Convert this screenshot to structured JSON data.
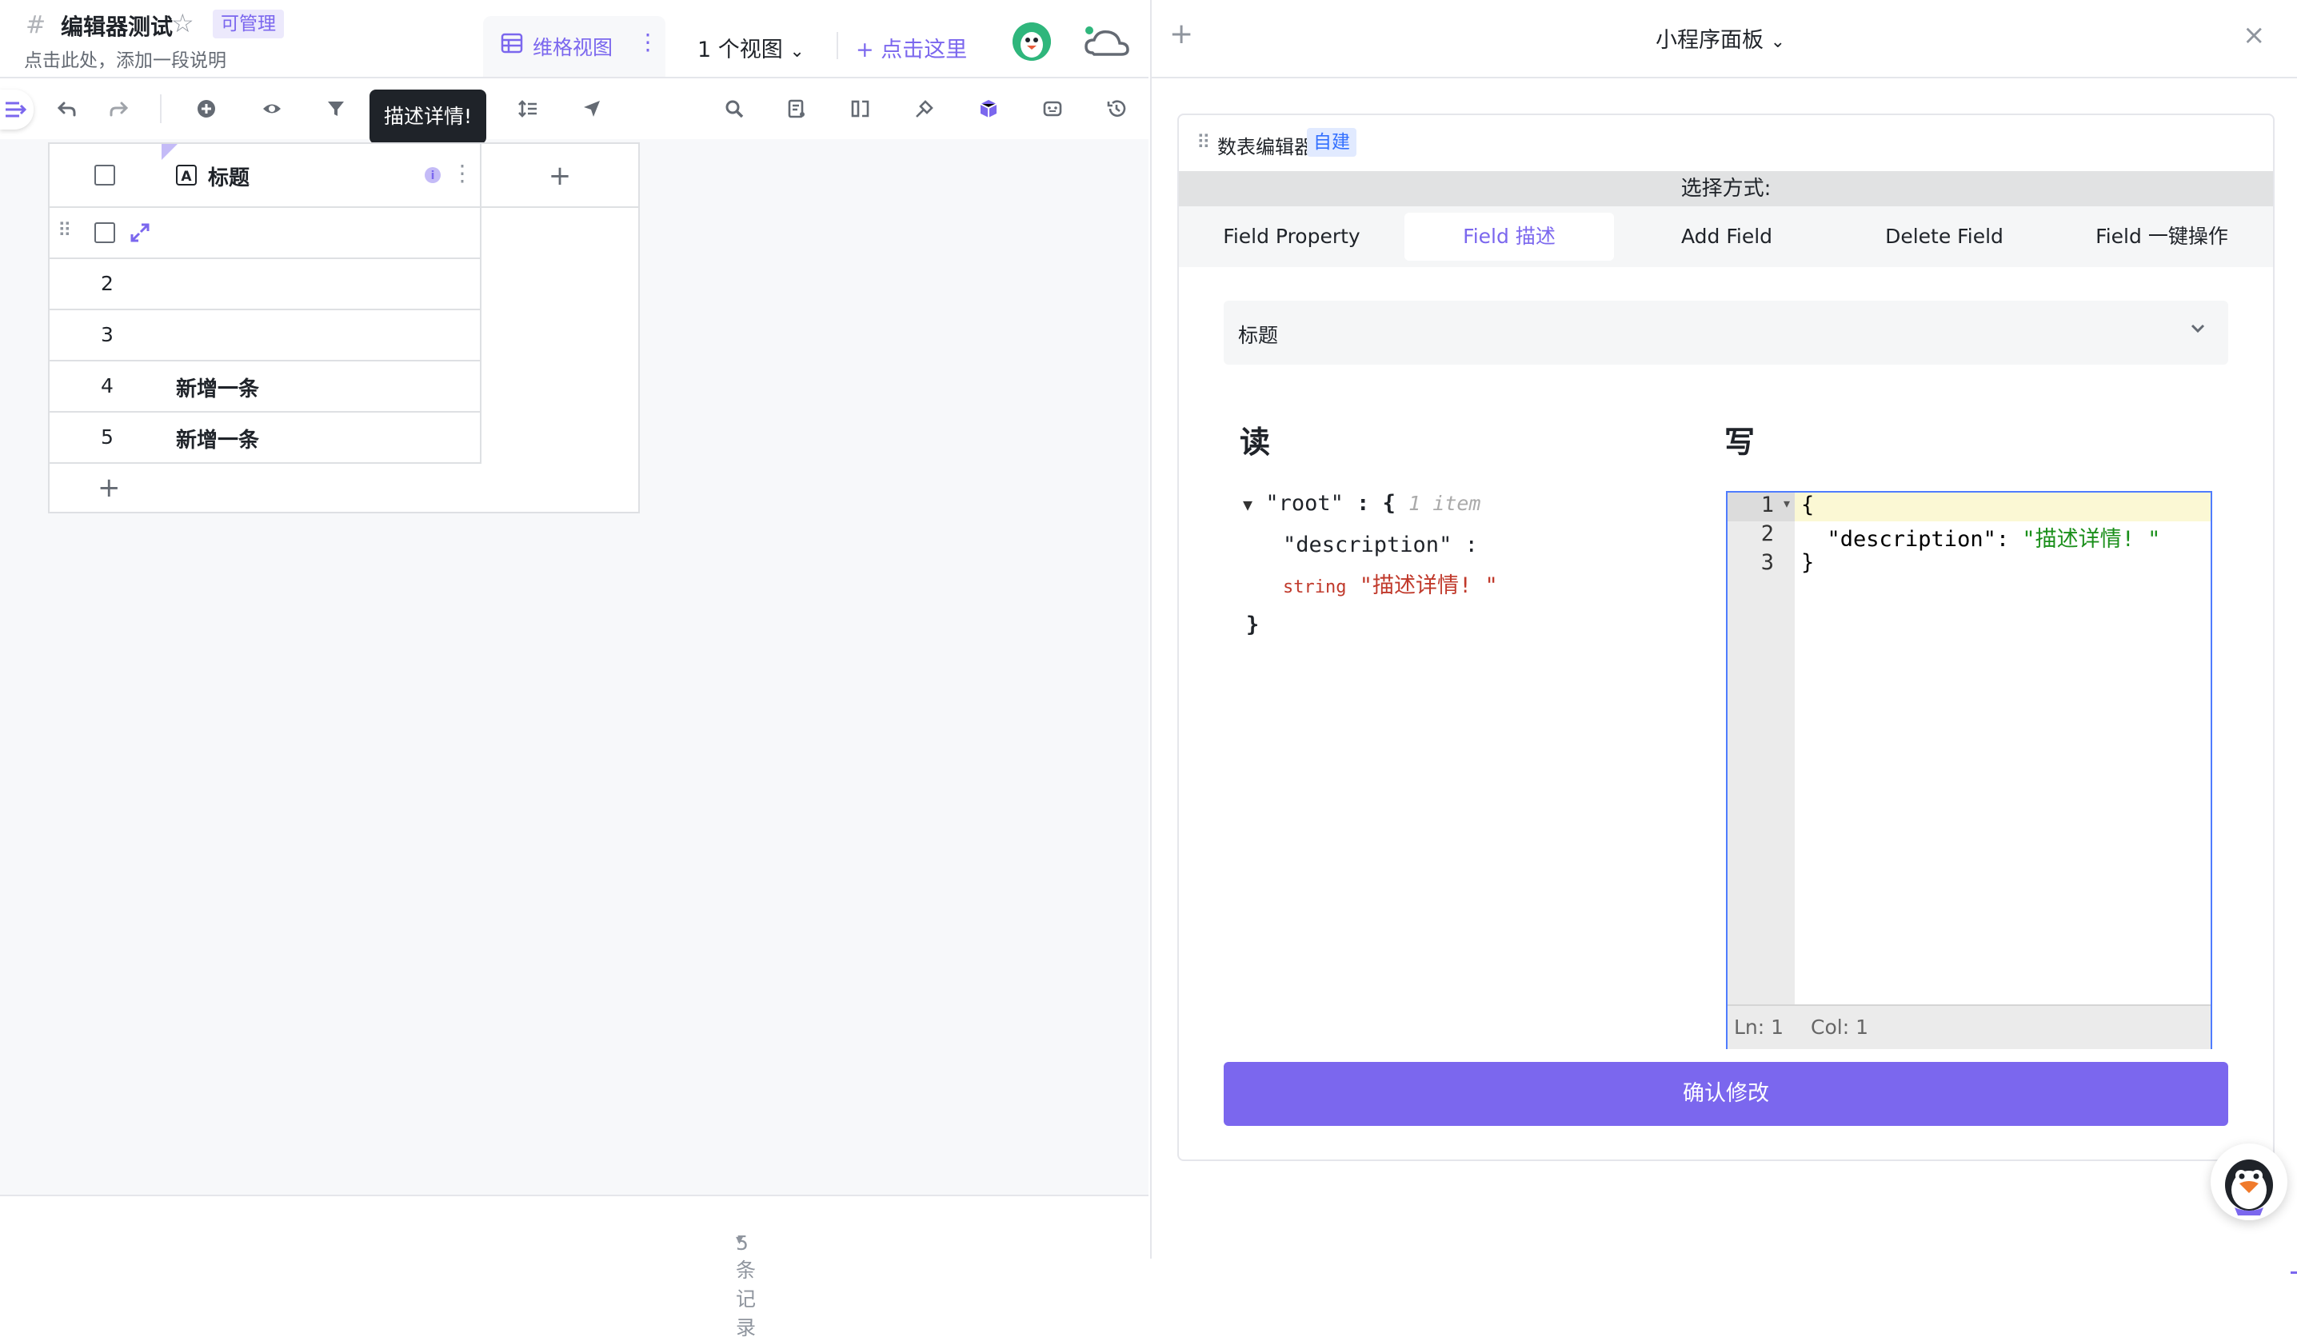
{
  "header": {
    "title": "编辑器测试",
    "badge": "可管理",
    "description": "点击此处，添加一段说明",
    "view_tab_label": "维格视图",
    "view_count": "1 个视图",
    "add_view": "点击这里"
  },
  "tooltip": "描述详情!",
  "grid": {
    "field_name": "标题",
    "rows": [
      {
        "num": "",
        "text": ""
      },
      {
        "num": "2",
        "text": ""
      },
      {
        "num": "3",
        "text": ""
      },
      {
        "num": "4",
        "text": "新增一条"
      },
      {
        "num": "5",
        "text": "新增一条"
      }
    ]
  },
  "footer": {
    "record_count": "5 条记录"
  },
  "panel": {
    "title": "小程序面板",
    "widget_name": "数表编辑器",
    "widget_badge": "自建",
    "select_label": "选择方式:",
    "tabs": [
      "Field Property",
      "Field 描述",
      "Add Field",
      "Delete Field",
      "Field 一键操作"
    ],
    "active_tab": 1,
    "field_select": "标题",
    "read_heading": "读",
    "write_heading": "写",
    "json_view": {
      "root_key": "\"root\"",
      "root_brace": ": {",
      "item_count": "1 item",
      "desc_key": "\"description\" :",
      "type_label": "string",
      "desc_value": "\"描述详情! \"",
      "close_brace": "}"
    },
    "editor": {
      "line_numbers": [
        "1",
        "2",
        "3"
      ],
      "lines": [
        "{",
        "  \"description\": ",
        "}"
      ],
      "desc_value": "\"描述详情! \"",
      "status_ln": "Ln: 1",
      "status_col": "Col: 1"
    },
    "confirm_label": "确认修改"
  },
  "colors": {
    "accent": "#7b67ee",
    "json_string": "#c0392b",
    "editor_string": "#1a8f1a"
  }
}
